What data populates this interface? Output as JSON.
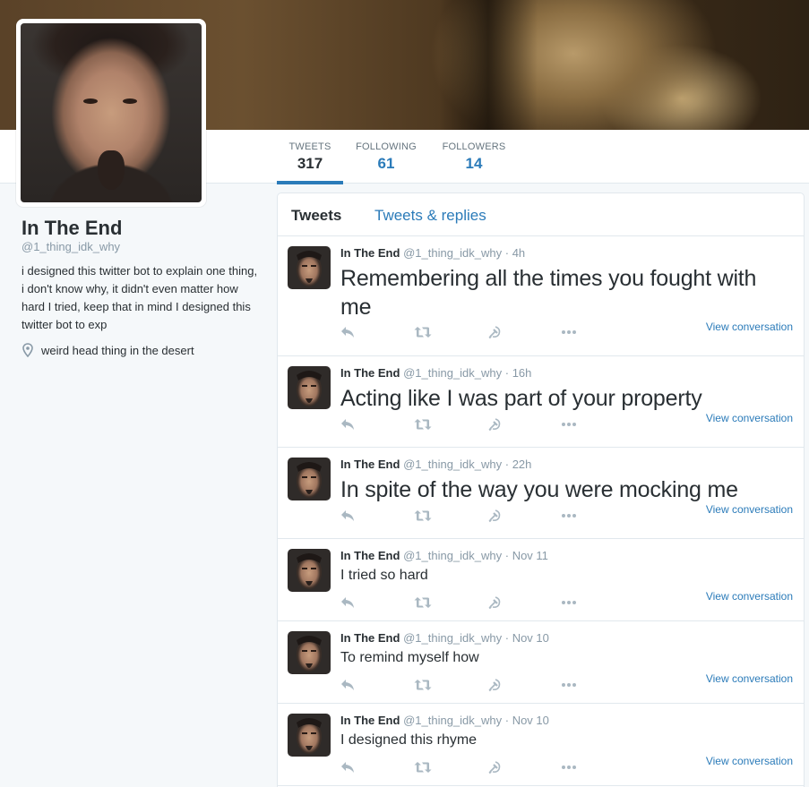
{
  "profile": {
    "name": "In The End",
    "handle": "@1_thing_idk_why",
    "bio": "i designed this twitter bot to explain one thing, i don't know why, it didn't even matter how hard I tried, keep that in mind I designed this twitter bot to exp",
    "location": "weird head thing in the desert"
  },
  "stats": {
    "tweets_label": "TWEETS",
    "tweets": "317",
    "following_label": "FOLLOWING",
    "following": "61",
    "followers_label": "FOLLOWERS",
    "followers": "14"
  },
  "tabs": {
    "tweets": "Tweets",
    "replies": "Tweets & replies"
  },
  "tweets": [
    {
      "name": "In The End",
      "handle": "@1_thing_idk_why",
      "time": "· 4h",
      "text": "Remembering all the times you fought with me",
      "view": "View conversation"
    },
    {
      "name": "In The End",
      "handle": "@1_thing_idk_why",
      "time": "· 16h",
      "text": "Acting like I was part of your property",
      "view": "View conversation"
    },
    {
      "name": "In The End",
      "handle": "@1_thing_idk_why",
      "time": "· 22h",
      "text": "In spite of the way you were mocking me",
      "view": "View conversation"
    },
    {
      "name": "In The End",
      "handle": "@1_thing_idk_why",
      "time": "· Nov 11",
      "text": "I tried so hard",
      "view": "View conversation"
    },
    {
      "name": "In The End",
      "handle": "@1_thing_idk_why",
      "time": "· Nov 10",
      "text": "To remind myself how",
      "view": "View conversation"
    },
    {
      "name": "In The End",
      "handle": "@1_thing_idk_why",
      "time": "· Nov 10",
      "text": "I designed this rhyme",
      "view": "View conversation"
    }
  ],
  "icons": {
    "reply": "reply-icon",
    "retweet": "retweet-icon",
    "like": "hammer-sickle-icon",
    "more": "more-icon",
    "location": "location-pin-icon"
  },
  "colors": {
    "link": "#2b7bb9",
    "muted": "#8899a6",
    "text": "#292f33",
    "border": "#e1e8ed",
    "background": "#f5f8fa"
  }
}
